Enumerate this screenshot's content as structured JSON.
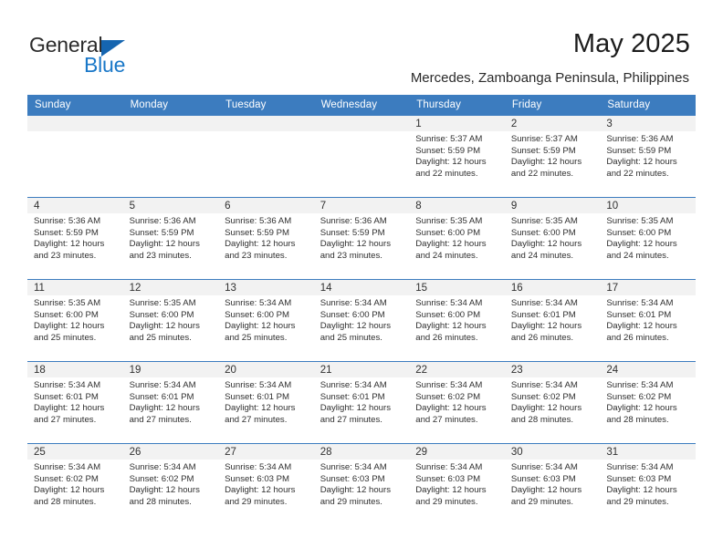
{
  "brand": {
    "name_top": "General",
    "name_bottom": "Blue",
    "triangle_color": "#1565b0",
    "blue_text_color": "#1a78c8"
  },
  "header": {
    "title": "May 2025",
    "subtitle": "Mercedes, Zamboanga Peninsula, Philippines"
  },
  "theme": {
    "header_row_bg": "#3c7cbf",
    "header_row_text": "#ffffff",
    "daynum_band_bg": "#f2f2f2",
    "cell_border": "#3c7cbf",
    "body_text": "#2f2f2f"
  },
  "calendar": {
    "weekday_headers": [
      "Sunday",
      "Monday",
      "Tuesday",
      "Wednesday",
      "Thursday",
      "Friday",
      "Saturday"
    ],
    "labels": {
      "sunrise": "Sunrise:",
      "sunset": "Sunset:",
      "daylight": "Daylight:"
    },
    "weeks": [
      [
        {
          "day": "",
          "empty": true
        },
        {
          "day": "",
          "empty": true
        },
        {
          "day": "",
          "empty": true
        },
        {
          "day": "",
          "empty": true
        },
        {
          "day": "1",
          "sunrise": "Sunrise: 5:37 AM",
          "sunset": "Sunset: 5:59 PM",
          "daylight_1": "Daylight: 12 hours",
          "daylight_2": "and 22 minutes."
        },
        {
          "day": "2",
          "sunrise": "Sunrise: 5:37 AM",
          "sunset": "Sunset: 5:59 PM",
          "daylight_1": "Daylight: 12 hours",
          "daylight_2": "and 22 minutes."
        },
        {
          "day": "3",
          "sunrise": "Sunrise: 5:36 AM",
          "sunset": "Sunset: 5:59 PM",
          "daylight_1": "Daylight: 12 hours",
          "daylight_2": "and 22 minutes."
        }
      ],
      [
        {
          "day": "4",
          "sunrise": "Sunrise: 5:36 AM",
          "sunset": "Sunset: 5:59 PM",
          "daylight_1": "Daylight: 12 hours",
          "daylight_2": "and 23 minutes."
        },
        {
          "day": "5",
          "sunrise": "Sunrise: 5:36 AM",
          "sunset": "Sunset: 5:59 PM",
          "daylight_1": "Daylight: 12 hours",
          "daylight_2": "and 23 minutes."
        },
        {
          "day": "6",
          "sunrise": "Sunrise: 5:36 AM",
          "sunset": "Sunset: 5:59 PM",
          "daylight_1": "Daylight: 12 hours",
          "daylight_2": "and 23 minutes."
        },
        {
          "day": "7",
          "sunrise": "Sunrise: 5:36 AM",
          "sunset": "Sunset: 5:59 PM",
          "daylight_1": "Daylight: 12 hours",
          "daylight_2": "and 23 minutes."
        },
        {
          "day": "8",
          "sunrise": "Sunrise: 5:35 AM",
          "sunset": "Sunset: 6:00 PM",
          "daylight_1": "Daylight: 12 hours",
          "daylight_2": "and 24 minutes."
        },
        {
          "day": "9",
          "sunrise": "Sunrise: 5:35 AM",
          "sunset": "Sunset: 6:00 PM",
          "daylight_1": "Daylight: 12 hours",
          "daylight_2": "and 24 minutes."
        },
        {
          "day": "10",
          "sunrise": "Sunrise: 5:35 AM",
          "sunset": "Sunset: 6:00 PM",
          "daylight_1": "Daylight: 12 hours",
          "daylight_2": "and 24 minutes."
        }
      ],
      [
        {
          "day": "11",
          "sunrise": "Sunrise: 5:35 AM",
          "sunset": "Sunset: 6:00 PM",
          "daylight_1": "Daylight: 12 hours",
          "daylight_2": "and 25 minutes."
        },
        {
          "day": "12",
          "sunrise": "Sunrise: 5:35 AM",
          "sunset": "Sunset: 6:00 PM",
          "daylight_1": "Daylight: 12 hours",
          "daylight_2": "and 25 minutes."
        },
        {
          "day": "13",
          "sunrise": "Sunrise: 5:34 AM",
          "sunset": "Sunset: 6:00 PM",
          "daylight_1": "Daylight: 12 hours",
          "daylight_2": "and 25 minutes."
        },
        {
          "day": "14",
          "sunrise": "Sunrise: 5:34 AM",
          "sunset": "Sunset: 6:00 PM",
          "daylight_1": "Daylight: 12 hours",
          "daylight_2": "and 25 minutes."
        },
        {
          "day": "15",
          "sunrise": "Sunrise: 5:34 AM",
          "sunset": "Sunset: 6:00 PM",
          "daylight_1": "Daylight: 12 hours",
          "daylight_2": "and 26 minutes."
        },
        {
          "day": "16",
          "sunrise": "Sunrise: 5:34 AM",
          "sunset": "Sunset: 6:01 PM",
          "daylight_1": "Daylight: 12 hours",
          "daylight_2": "and 26 minutes."
        },
        {
          "day": "17",
          "sunrise": "Sunrise: 5:34 AM",
          "sunset": "Sunset: 6:01 PM",
          "daylight_1": "Daylight: 12 hours",
          "daylight_2": "and 26 minutes."
        }
      ],
      [
        {
          "day": "18",
          "sunrise": "Sunrise: 5:34 AM",
          "sunset": "Sunset: 6:01 PM",
          "daylight_1": "Daylight: 12 hours",
          "daylight_2": "and 27 minutes."
        },
        {
          "day": "19",
          "sunrise": "Sunrise: 5:34 AM",
          "sunset": "Sunset: 6:01 PM",
          "daylight_1": "Daylight: 12 hours",
          "daylight_2": "and 27 minutes."
        },
        {
          "day": "20",
          "sunrise": "Sunrise: 5:34 AM",
          "sunset": "Sunset: 6:01 PM",
          "daylight_1": "Daylight: 12 hours",
          "daylight_2": "and 27 minutes."
        },
        {
          "day": "21",
          "sunrise": "Sunrise: 5:34 AM",
          "sunset": "Sunset: 6:01 PM",
          "daylight_1": "Daylight: 12 hours",
          "daylight_2": "and 27 minutes."
        },
        {
          "day": "22",
          "sunrise": "Sunrise: 5:34 AM",
          "sunset": "Sunset: 6:02 PM",
          "daylight_1": "Daylight: 12 hours",
          "daylight_2": "and 27 minutes."
        },
        {
          "day": "23",
          "sunrise": "Sunrise: 5:34 AM",
          "sunset": "Sunset: 6:02 PM",
          "daylight_1": "Daylight: 12 hours",
          "daylight_2": "and 28 minutes."
        },
        {
          "day": "24",
          "sunrise": "Sunrise: 5:34 AM",
          "sunset": "Sunset: 6:02 PM",
          "daylight_1": "Daylight: 12 hours",
          "daylight_2": "and 28 minutes."
        }
      ],
      [
        {
          "day": "25",
          "sunrise": "Sunrise: 5:34 AM",
          "sunset": "Sunset: 6:02 PM",
          "daylight_1": "Daylight: 12 hours",
          "daylight_2": "and 28 minutes."
        },
        {
          "day": "26",
          "sunrise": "Sunrise: 5:34 AM",
          "sunset": "Sunset: 6:02 PM",
          "daylight_1": "Daylight: 12 hours",
          "daylight_2": "and 28 minutes."
        },
        {
          "day": "27",
          "sunrise": "Sunrise: 5:34 AM",
          "sunset": "Sunset: 6:03 PM",
          "daylight_1": "Daylight: 12 hours",
          "daylight_2": "and 29 minutes."
        },
        {
          "day": "28",
          "sunrise": "Sunrise: 5:34 AM",
          "sunset": "Sunset: 6:03 PM",
          "daylight_1": "Daylight: 12 hours",
          "daylight_2": "and 29 minutes."
        },
        {
          "day": "29",
          "sunrise": "Sunrise: 5:34 AM",
          "sunset": "Sunset: 6:03 PM",
          "daylight_1": "Daylight: 12 hours",
          "daylight_2": "and 29 minutes."
        },
        {
          "day": "30",
          "sunrise": "Sunrise: 5:34 AM",
          "sunset": "Sunset: 6:03 PM",
          "daylight_1": "Daylight: 12 hours",
          "daylight_2": "and 29 minutes."
        },
        {
          "day": "31",
          "sunrise": "Sunrise: 5:34 AM",
          "sunset": "Sunset: 6:03 PM",
          "daylight_1": "Daylight: 12 hours",
          "daylight_2": "and 29 minutes."
        }
      ]
    ]
  }
}
